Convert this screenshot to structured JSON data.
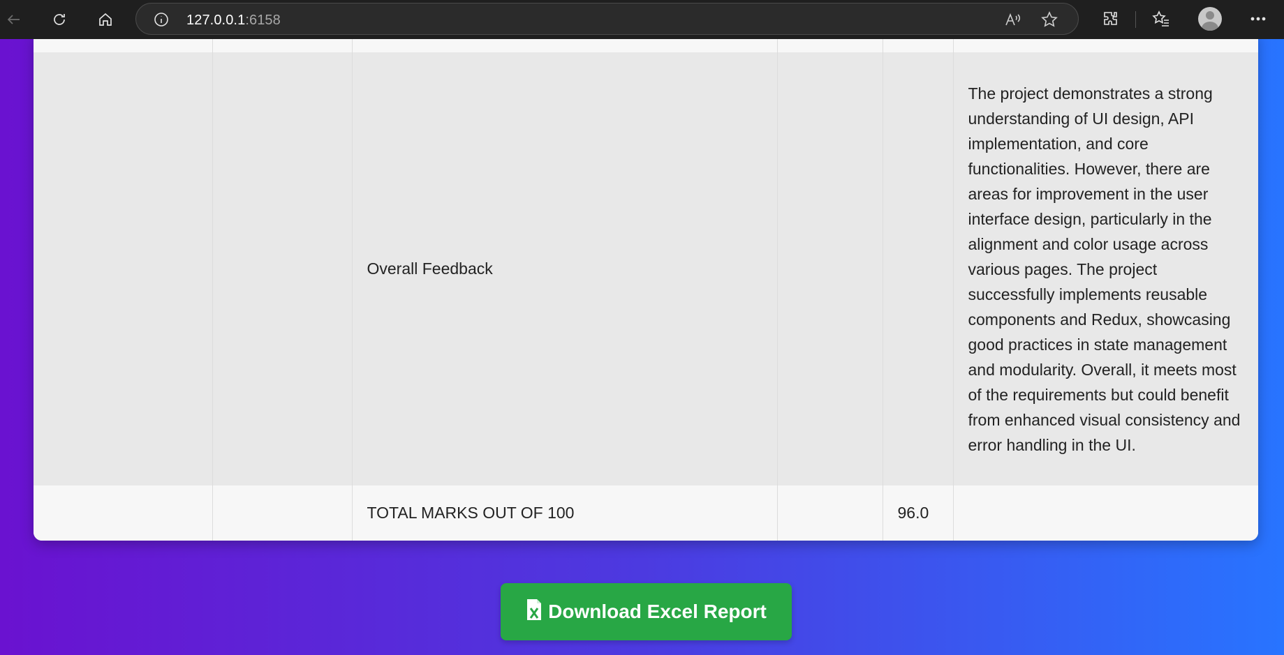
{
  "browser": {
    "url_host": "127.0.0.1",
    "url_port": ":6158"
  },
  "table": {
    "feedback_row": {
      "label": "Overall Feedback",
      "feedback": "The project demonstrates a strong understanding of UI design, API implementation, and core functionalities. However, there are areas for improvement in the user interface design, particularly in the alignment and color usage across various pages. The project successfully implements reusable components and Redux, showcasing good practices in state management and modularity. Overall, it meets most of the requirements but could benefit from enhanced visual consistency and error handling in the UI."
    },
    "total_row": {
      "label": "TOTAL MARKS OUT OF 100",
      "marks": "96.0"
    }
  },
  "download_button": {
    "label": "Download Excel Report"
  },
  "colors": {
    "gradient_start": "#6a12d0",
    "gradient_end": "#2874ff",
    "button_green": "#28a745"
  }
}
